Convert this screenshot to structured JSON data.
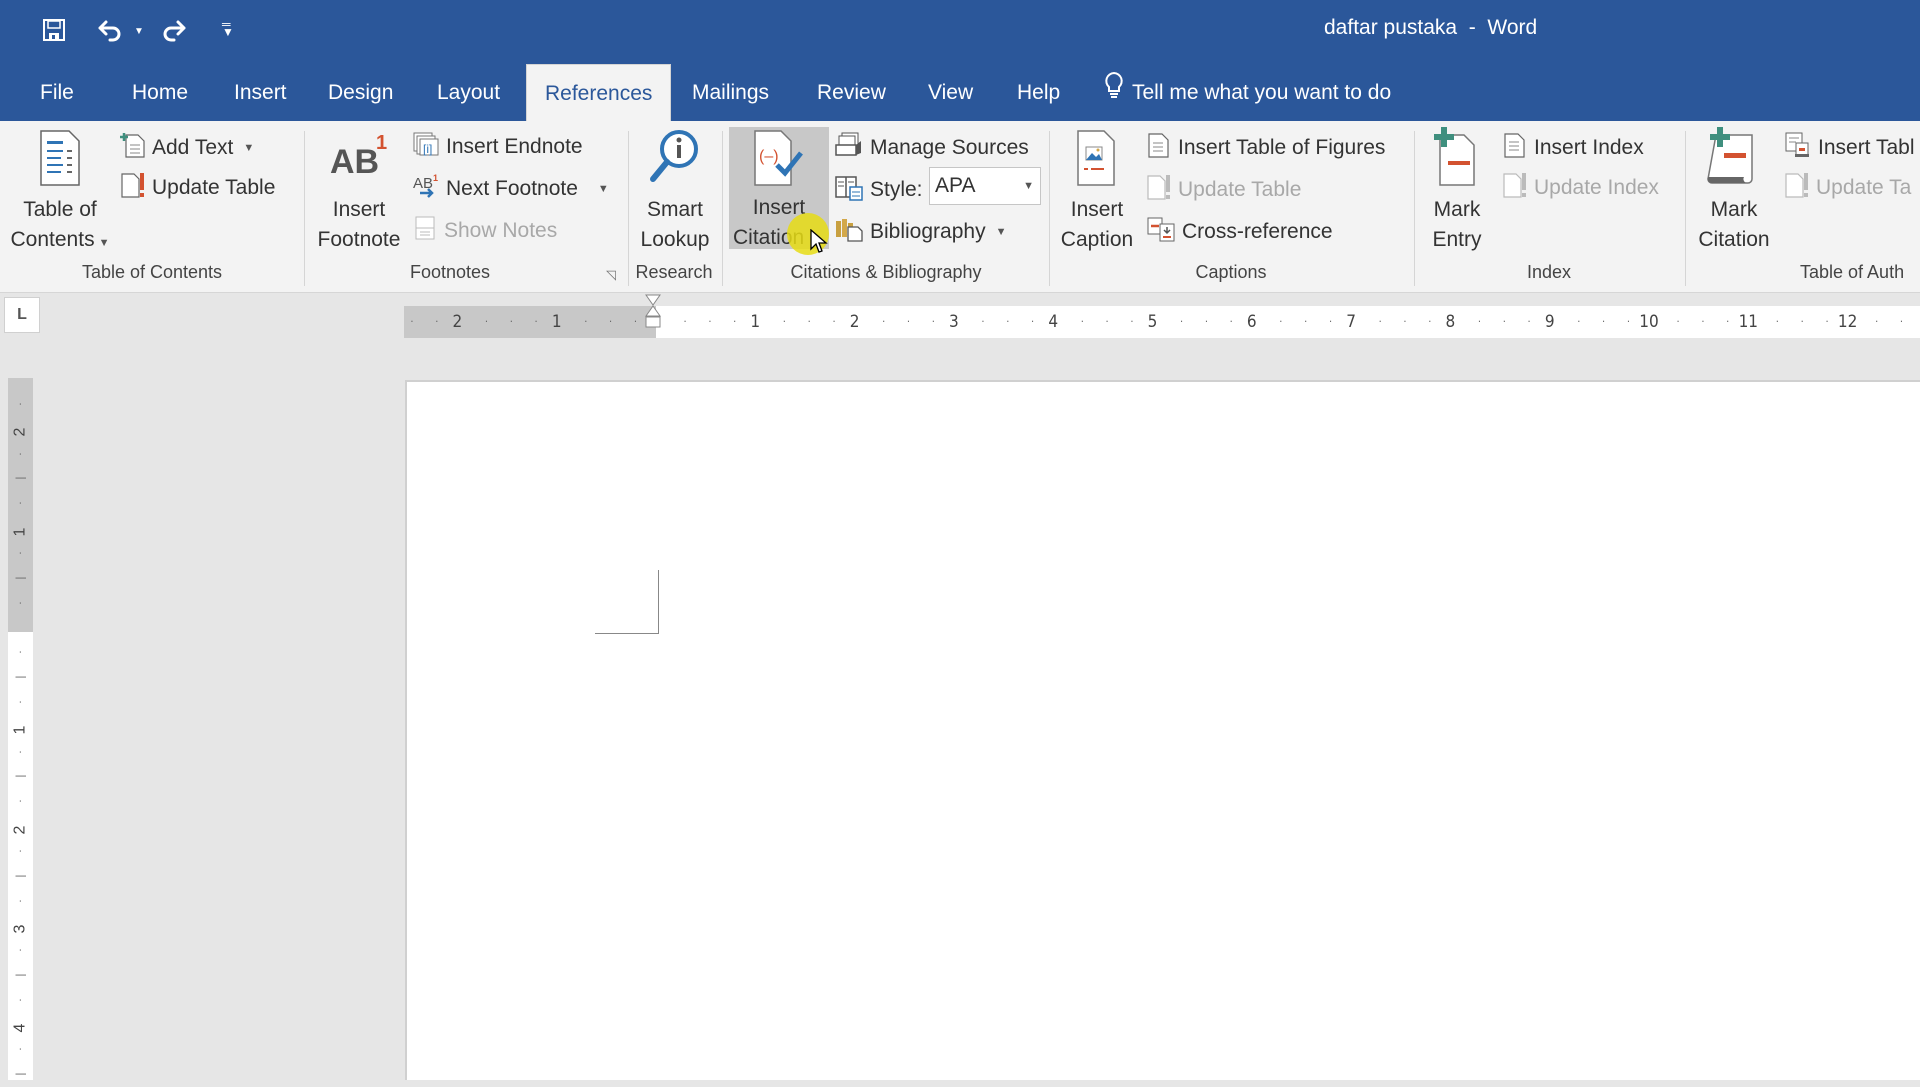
{
  "app": {
    "document_title": "daftar pustaka  -  Word",
    "quick_access": {
      "save": "save-icon",
      "undo": "undo-icon",
      "redo": "redo-icon",
      "customize": "customize-qat-icon"
    }
  },
  "tabs": [
    {
      "label": "File",
      "active": false
    },
    {
      "label": "Home",
      "active": false
    },
    {
      "label": "Insert",
      "active": false
    },
    {
      "label": "Design",
      "active": false
    },
    {
      "label": "Layout",
      "active": false
    },
    {
      "label": "References",
      "active": true
    },
    {
      "label": "Mailings",
      "active": false
    },
    {
      "label": "Review",
      "active": false
    },
    {
      "label": "View",
      "active": false
    },
    {
      "label": "Help",
      "active": false
    }
  ],
  "tell_me": "Tell me what you want to do",
  "ribbon": {
    "toc": {
      "group_label": "Table of Contents",
      "table_of_contents_line1": "Table of",
      "table_of_contents_line2": "Contents",
      "add_text": "Add Text",
      "update_table": "Update Table"
    },
    "footnotes": {
      "group_label": "Footnotes",
      "insert_footnote_line1": "Insert",
      "insert_footnote_line2": "Footnote",
      "insert_endnote": "Insert Endnote",
      "next_footnote": "Next Footnote",
      "show_notes": "Show Notes"
    },
    "research": {
      "group_label": "Research",
      "smart_lookup_line1": "Smart",
      "smart_lookup_line2": "Lookup"
    },
    "citations": {
      "group_label": "Citations & Bibliography",
      "insert_citation_line1": "Insert",
      "insert_citation_line2": "Citation",
      "manage_sources": "Manage Sources",
      "style_label": "Style:",
      "style_value": "APA",
      "bibliography": "Bibliography"
    },
    "captions": {
      "group_label": "Captions",
      "insert_caption_line1": "Insert",
      "insert_caption_line2": "Caption",
      "insert_table_of_figures": "Insert Table of Figures",
      "update_table": "Update Table",
      "cross_reference": "Cross-reference"
    },
    "index": {
      "group_label": "Index",
      "mark_entry_line1": "Mark",
      "mark_entry_line2": "Entry",
      "insert_index": "Insert Index",
      "update_index": "Update Index"
    },
    "authorities": {
      "group_label": "Table of Auth",
      "mark_citation_line1": "Mark",
      "mark_citation_line2": "Citation",
      "insert_table": "Insert Tabl",
      "update_table": "Update Ta"
    }
  },
  "ruler": {
    "tab_selector": "L",
    "horizontal_margin_labels": [
      "2",
      "1"
    ],
    "horizontal_labels": [
      "1",
      "2",
      "3",
      "4",
      "5",
      "6",
      "7",
      "8",
      "9",
      "10",
      "11",
      "12"
    ],
    "vertical_margin_labels": [
      "2",
      "1"
    ],
    "vertical_labels": [
      "1",
      "2",
      "3",
      "4"
    ]
  },
  "colors": {
    "brand_blue": "#2b579a",
    "ribbon_bg": "#f3f3f3",
    "accent_orange": "#d35230",
    "icon_blue": "#2f74b5",
    "icon_green": "#3f8f7e",
    "cursor_highlight": "#e6dc14"
  }
}
